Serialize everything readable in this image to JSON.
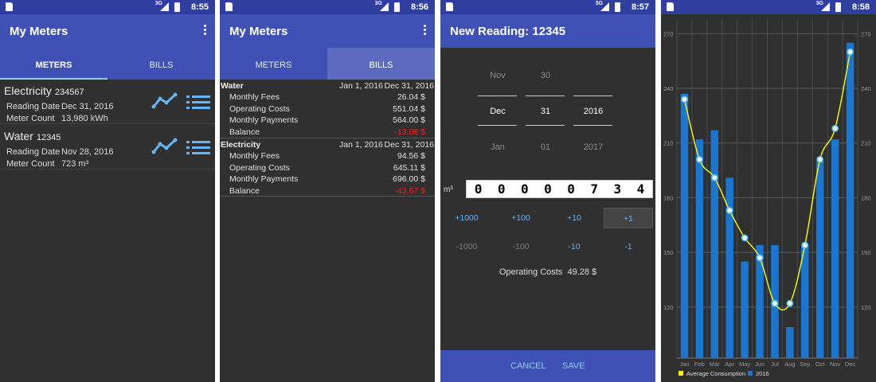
{
  "screens": [
    {
      "time": "8:55",
      "network": "3G",
      "title": "My Meters",
      "tabs": [
        "METERS",
        "BILLS"
      ],
      "meters": [
        {
          "name": "Electricity",
          "number": "234567",
          "reading_date_label": "Reading Date",
          "reading_date": "Dec 31, 2016",
          "count_label": "Meter Count",
          "count": "13,980 kWh"
        },
        {
          "name": "Water",
          "number": "12345",
          "reading_date_label": "Reading Date",
          "reading_date": "Nov 28, 2016",
          "count_label": "Meter Count",
          "count": "723 m³"
        }
      ]
    },
    {
      "time": "8:56",
      "network": "3G",
      "title": "My Meters",
      "tabs": [
        "METERS",
        "BILLS"
      ],
      "bills": [
        {
          "name": "Water",
          "from": "Jan 1, 2016",
          "to": "Dec 31, 2016",
          "rows": [
            {
              "label": "Monthly Fees",
              "value": "26.04 $",
              "negative": false
            },
            {
              "label": "Operating Costs",
              "value": "551.04 $",
              "negative": false
            },
            {
              "label": "Monthly Payments",
              "value": "564.00 $",
              "negative": false
            },
            {
              "label": "Balance",
              "value": "-13.08 $",
              "negative": true
            }
          ]
        },
        {
          "name": "Electricity",
          "from": "Jan 1, 2016",
          "to": "Dec 31, 2016",
          "rows": [
            {
              "label": "Monthly Fees",
              "value": "94.56 $",
              "negative": false
            },
            {
              "label": "Operating Costs",
              "value": "645.11 $",
              "negative": false
            },
            {
              "label": "Monthly Payments",
              "value": "696.00 $",
              "negative": false
            },
            {
              "label": "Balance",
              "value": "-43.67 $",
              "negative": true
            }
          ]
        }
      ]
    },
    {
      "time": "8:57",
      "network": "3G",
      "title": "New Reading: 12345",
      "picker": {
        "month": {
          "prev": "Nov",
          "selected": "Dec",
          "next": "Jan"
        },
        "day": {
          "prev": "30",
          "selected": "31",
          "next": "01"
        },
        "year": {
          "prev": "",
          "selected": "2016",
          "next": "2017"
        }
      },
      "unit": "m³",
      "digits": [
        "0",
        "0",
        "0",
        "0",
        "0",
        "7",
        "3",
        "4"
      ],
      "increments": [
        "+1000",
        "+100",
        "+10",
        "+1"
      ],
      "decrements": [
        "-1000",
        "-100",
        "-10",
        "-1"
      ],
      "operating_costs_label": "Operating Costs",
      "operating_costs_value": "49.28 $",
      "cancel": "CANCEL",
      "save": "SAVE"
    },
    {
      "time": "8:58",
      "network": "3G"
    }
  ],
  "chart_data": {
    "type": "bar",
    "categories": [
      "Jan",
      "Feb",
      "Mar",
      "Apr",
      "May",
      "Jun",
      "Jul",
      "Aug",
      "Sep",
      "Oct",
      "Nov",
      "Dec"
    ],
    "series": [
      {
        "name": "2016",
        "type": "bar",
        "color": "#1976d2",
        "values": [
          237,
          212,
          217,
          191,
          145,
          154,
          154,
          109,
          154,
          200,
          212,
          265
        ]
      },
      {
        "name": "Average Consumption",
        "type": "line",
        "color": "#ffff00",
        "values": [
          234,
          201,
          191,
          173,
          158,
          147,
          122,
          122,
          154,
          201,
          218,
          260
        ]
      }
    ],
    "ylim": [
      92,
      278
    ],
    "yticks": [
      "120",
      "150",
      "180",
      "210",
      "240",
      "270"
    ],
    "grid": true,
    "legend_position": "bottom-left"
  }
}
